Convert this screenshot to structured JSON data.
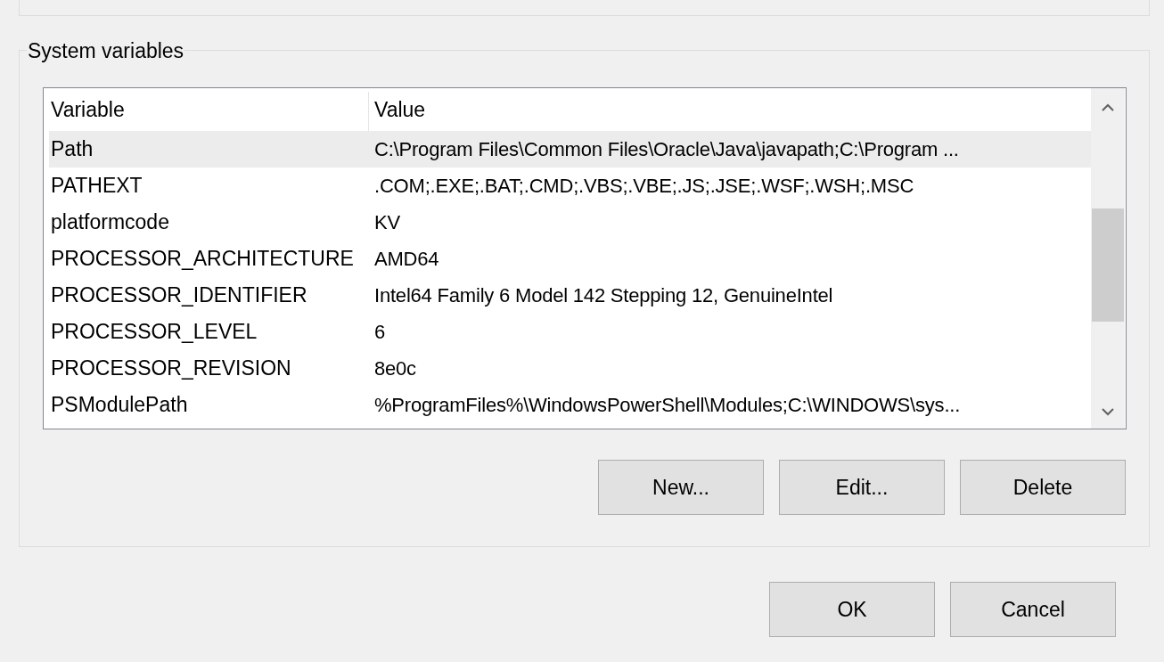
{
  "group": {
    "title": "System variables"
  },
  "table": {
    "columns": [
      "Variable",
      "Value"
    ],
    "rows": [
      {
        "variable": "Path",
        "value": "C:\\Program Files\\Common Files\\Oracle\\Java\\javapath;C:\\Program ...",
        "selected": true
      },
      {
        "variable": "PATHEXT",
        "value": ".COM;.EXE;.BAT;.CMD;.VBS;.VBE;.JS;.JSE;.WSF;.WSH;.MSC",
        "selected": false
      },
      {
        "variable": "platformcode",
        "value": "KV",
        "selected": false
      },
      {
        "variable": "PROCESSOR_ARCHITECTURE",
        "value": "AMD64",
        "selected": false
      },
      {
        "variable": "PROCESSOR_IDENTIFIER",
        "value": "Intel64 Family 6 Model 142 Stepping 12, GenuineIntel",
        "selected": false
      },
      {
        "variable": "PROCESSOR_LEVEL",
        "value": "6",
        "selected": false
      },
      {
        "variable": "PROCESSOR_REVISION",
        "value": "8e0c",
        "selected": false
      },
      {
        "variable": "PSModulePath",
        "value": "%ProgramFiles%\\WindowsPowerShell\\Modules;C:\\WINDOWS\\sys...",
        "selected": false
      }
    ]
  },
  "group_buttons": [
    "New...",
    "Edit...",
    "Delete"
  ],
  "dialog_buttons": [
    "OK",
    "Cancel"
  ]
}
